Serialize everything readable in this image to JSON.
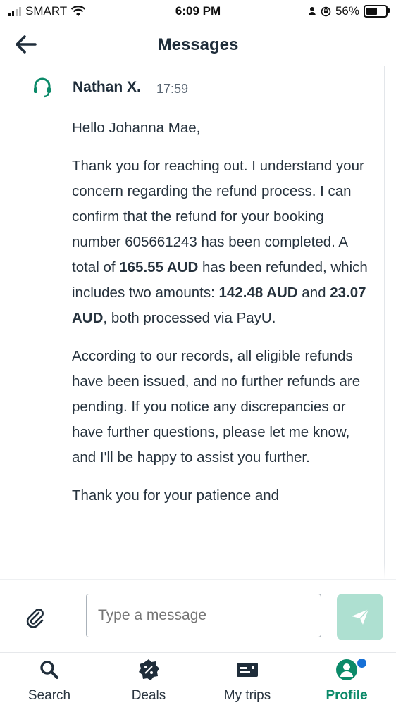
{
  "status_bar": {
    "carrier": "SMART",
    "time": "6:09 PM",
    "battery": "56%",
    "battery_level": 0.56
  },
  "header": {
    "title": "Messages",
    "back_icon": "arrow-left-icon"
  },
  "message": {
    "sender": "Nathan X.",
    "time": "17:59",
    "avatar_icon": "headset-icon",
    "greeting": "Hello Johanna Mae,",
    "p1_a": "Thank you for reaching out. I understand your concern regarding the refund process. I can confirm that the refund for your booking number 605661243 has been completed. A total of ",
    "p1_total": "165.55 AUD",
    "p1_b": " has been refunded, which includes two amounts: ",
    "p1_amount1": "142.48 AUD",
    "p1_c": " and ",
    "p1_amount2": "23.07 AUD",
    "p1_d": ", both processed via PayU.",
    "p2": "According to our records, all eligible refunds have been issued, and no further refunds are pending. If you notice any discrepancies or have further questions, please let me know, and I'll be happy to assist you further.",
    "p3": "Thank you for your patience and"
  },
  "composer": {
    "placeholder": "Type a message",
    "attach_icon": "paperclip-icon",
    "send_icon": "send-icon"
  },
  "nav": {
    "items": [
      {
        "label": "Search",
        "icon": "search-icon"
      },
      {
        "label": "Deals",
        "icon": "deals-badge-icon"
      },
      {
        "label": "My trips",
        "icon": "trips-icon"
      },
      {
        "label": "Profile",
        "icon": "profile-icon"
      }
    ]
  },
  "colors": {
    "accent": "#0b8a69",
    "send_button": "#aee0d1",
    "notification_dot": "#1670d6"
  }
}
